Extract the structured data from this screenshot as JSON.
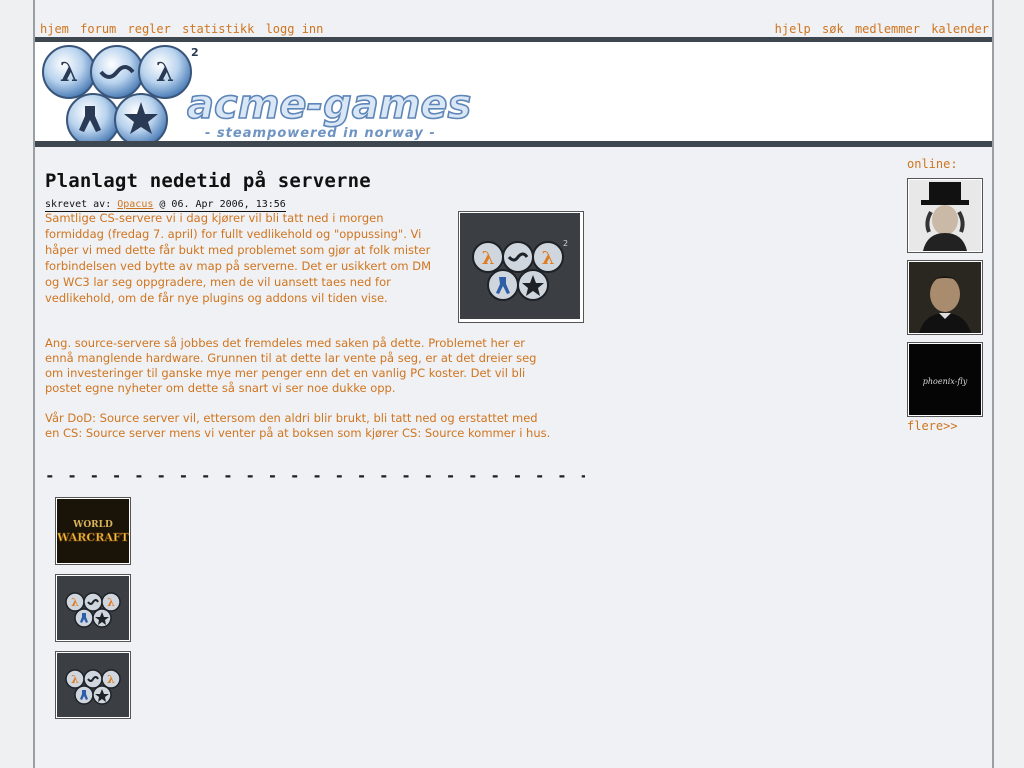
{
  "nav": {
    "left": [
      "hjem",
      "forum",
      "regler",
      "statistikk",
      "logg inn"
    ],
    "right": [
      "hjelp",
      "søk",
      "medlemmer",
      "kalender"
    ]
  },
  "banner": {
    "site_name": "acme-games",
    "tagline": "- steampowered in norway -"
  },
  "article": {
    "title": "Planlagt nedetid på serverne",
    "byline_prefix": "skrevet av: ",
    "author": "Opacus",
    "date": " @ 06. Apr 2006, 13:56",
    "paragraph1": "Samtlige CS-servere vi i dag kjører vil bli tatt ned i morgen formiddag (fredag 7. april) for fullt vedlikehold og \"oppussing\". Vi håper vi med dette får bukt med problemet som gjør at folk mister forbindelsen ved bytte av map på serverne. Det er usikkert om DM og WC3 lar seg oppgradere, men de vil uansett taes ned for vedlikehold, om de får nye plugins og addons vil tiden vise.",
    "paragraph2": "Ang. source-servere så jobbes det fremdeles med saken på dette. Problemet her er ennå manglende hardware. Grunnen til at dette lar vente på seg, er at det dreier seg om investeringer til ganske mye mer penger enn det en vanlig PC koster. Det vil bli postet egne nyheter om dette så snart vi ser noe dukke opp.",
    "paragraph3": "Vår DoD: Source server vil, ettersom den aldri blir brukt, bli tatt ned og erstattet med en CS: Source server mens vi venter på at boksen som kjører CS: Source kommer i hus.",
    "separator": "- - - - - - - - - - - - - - - - - - - - - - - - - - - - - - - - - - -"
  },
  "thumbs": {
    "wow_top": "WORLD",
    "wow_bottom": "WARCRAFT"
  },
  "online": {
    "label": "online:",
    "more": "flere>>",
    "avatar3_text": "phoenix-fly"
  },
  "colors": {
    "accent": "#d0751f",
    "bar": "#3e4750",
    "background": "#eff1f4"
  }
}
